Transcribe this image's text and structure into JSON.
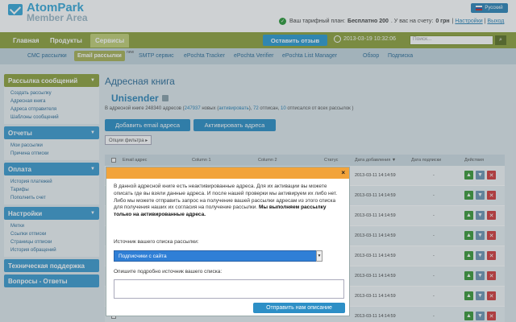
{
  "header": {
    "logo_title": "AtomPark",
    "logo_sub": "Member Area",
    "language": "Русский",
    "tariff_label": "Ваш тарифный план:",
    "tariff_value": "Бесплатно 200",
    "balance_label": ". У вас на счету:",
    "balance_value": "0 грн",
    "settings_link": "Настройки",
    "logout_link": "Выход"
  },
  "mainnav": {
    "tabs": [
      "Главная",
      "Продукты",
      "Сервисы"
    ],
    "active_tab": "Сервисы",
    "feedback_label": "Оставить отзыв",
    "datetime": "2013-03-19 10:32:06",
    "search_placeholder": "Поиск..."
  },
  "subnav": {
    "items": [
      "СМС рассылки",
      "Email рассылки",
      "SMTP сервис",
      "ePochta Tracker",
      "ePochta Verifier",
      "ePochta List Manager",
      "Обзор",
      "Подписка"
    ],
    "new_badge": "new"
  },
  "sidebar": {
    "sections": [
      {
        "title": "Рассылка сообщений",
        "items": [
          "Создать рассылку",
          "Адресная книга",
          "Адреса отправителя",
          "Шаблоны сообщений"
        ]
      },
      {
        "title": "Отчеты",
        "items": [
          "Мои рассылки",
          "Причина отписки"
        ]
      },
      {
        "title": "Оплата",
        "items": [
          "История платежей",
          "Тарифы",
          "Пополнить счет"
        ]
      },
      {
        "title": "Настройки",
        "items": [
          "Метки",
          "Ссылки отписки",
          "Страницы отписки",
          "История обращений"
        ]
      },
      {
        "title": "Техническая поддержка",
        "items": []
      },
      {
        "title": "Вопросы - Ответы",
        "items": []
      }
    ]
  },
  "content": {
    "page_title": "Адресная книга",
    "book_name": "Unisender",
    "stats_prefix": "В адресной книге 248340 адресов (",
    "stats_new": "247937",
    "stats_mid": " новых (",
    "stats_activate": "активировать",
    "stats_rest": "), ",
    "stats_unsub": "72",
    "stats_unsub_label": " отписан, ",
    "stats_unsub_all": "10",
    "stats_end": " отписался от всех рассылок )",
    "add_email_btn": "Добавить email адреса",
    "activate_btn": "Активировать адреса",
    "filter_btn": "Опции фильтра ▸",
    "columns": [
      "Email адрес",
      "Column 1",
      "Column 2",
      "Статус",
      "Дата добавления ▼",
      "Дата подписки",
      "Действия"
    ],
    "rows": [
      {
        "date": "2013-03-11 14:14:59",
        "sub": "-"
      },
      {
        "date": "2013-03-11 14:14:59",
        "sub": "-"
      },
      {
        "date": "2013-03-11 14:14:59",
        "sub": "-"
      },
      {
        "date": "2013-03-11 14:14:59",
        "sub": "-"
      },
      {
        "date": "2013-03-11 14:14:59",
        "sub": "-"
      },
      {
        "date": "2013-03-11 14:14:59",
        "sub": "-"
      },
      {
        "date": "2013-03-11 14:14:59",
        "sub": "-"
      },
      {
        "date": "2013-03-11 14:14:59",
        "sub": "-"
      }
    ]
  },
  "modal": {
    "text": "В данной адресной книге есть неактивированные адреса. Для их активации вы можете описать где вы взяли данные адреса. И после нашей проверки мы активируем их либо нет. Либо мы можете отправить запрос на получение вашей рассылки адресам из этого списка для получения наших их согласия на получение рассылки.",
    "bold_text": "Мы выполняем рассылку только на активированные адреса.",
    "source_label": "Источник вашего списка рассылки:",
    "source_value": "Подписчики с сайта",
    "describe_label": "Опишите подробно источник вашего списка:",
    "submit_label": "Отправить нам описание",
    "close": "×"
  }
}
